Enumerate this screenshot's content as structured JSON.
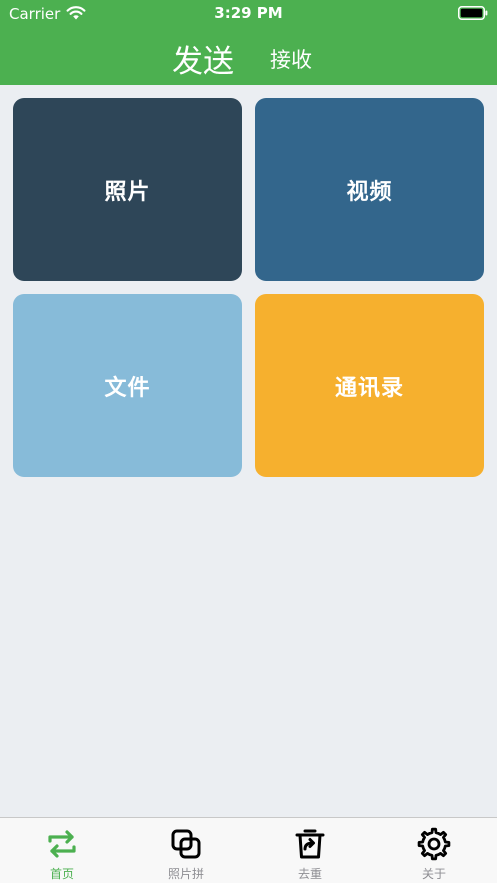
{
  "status_bar": {
    "carrier": "Carrier",
    "time": "3:29 PM"
  },
  "nav": {
    "send_tab": "发送",
    "receive_tab": "接收"
  },
  "tiles": [
    {
      "label": "照片",
      "color": "#2E4658"
    },
    {
      "label": "视频",
      "color": "#33668C"
    },
    {
      "label": "文件",
      "color": "#87BBD9"
    },
    {
      "label": "通讯录",
      "color": "#F6B02E"
    }
  ],
  "tab_bar": {
    "items": [
      {
        "label": "首页",
        "icon": "swap-arrows-icon",
        "active": true
      },
      {
        "label": "照片拼",
        "icon": "overlap-squares-icon",
        "active": false
      },
      {
        "label": "去重",
        "icon": "trash-share-icon",
        "active": false
      },
      {
        "label": "关于",
        "icon": "gear-icon",
        "active": false
      }
    ]
  },
  "colors": {
    "header": "#4CB050",
    "background": "#EBEEF2",
    "active_tab": "#4CB050",
    "inactive_tab": "#8E8E93"
  }
}
